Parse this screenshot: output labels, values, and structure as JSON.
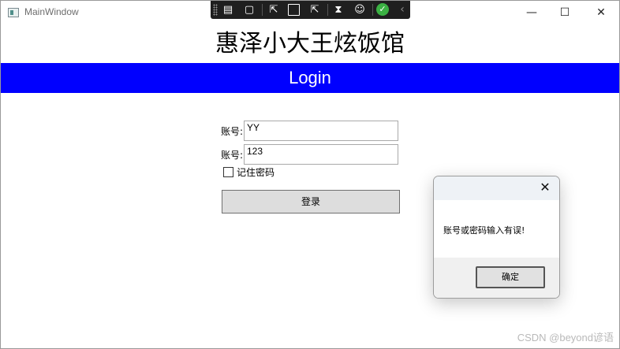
{
  "window": {
    "title": "MainWindow",
    "minimize_glyph": "—",
    "maximize_glyph": "☐",
    "close_glyph": "✕"
  },
  "debug_toolbar": {
    "icons": [
      "live-visual-tree-icon",
      "video-icon",
      "select-element-icon",
      "display-layout-adorners-icon",
      "track-focus-icon",
      "hot-reload-icon",
      "accessibility-icon",
      "hot-reload-status-icon",
      "collapse-chevron-icon"
    ]
  },
  "header": {
    "restaurant_name": "惠泽小大王炫饭馆",
    "banner_label": "Login",
    "banner_color": "#0000ff"
  },
  "form": {
    "account_label": "账号:",
    "account_value": "YY",
    "password_label": "账号:",
    "password_value": "123",
    "remember_label": "记住密码",
    "remember_checked": false,
    "login_button": "登录"
  },
  "dialog": {
    "message": "账号或密码输入有误!",
    "ok_label": "确定",
    "close_glyph": "✕"
  },
  "watermark": "CSDN @beyond谚语"
}
